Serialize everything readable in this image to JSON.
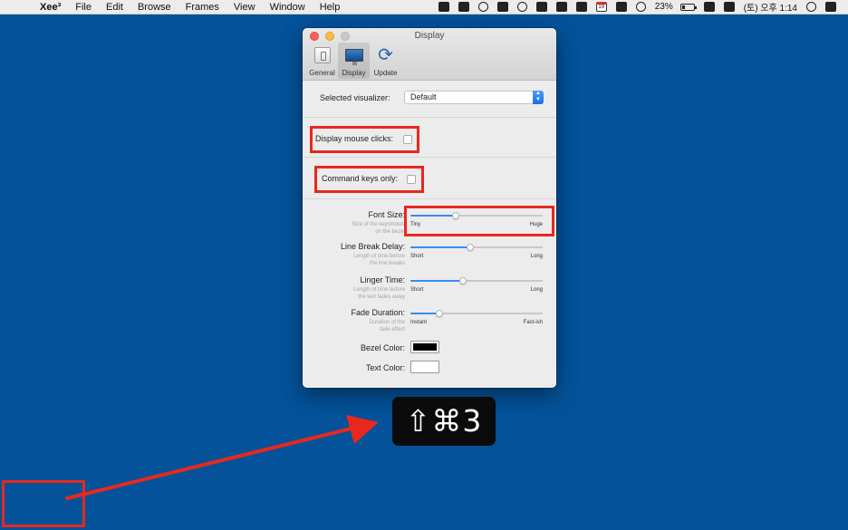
{
  "menubar": {
    "app_name": "Xee³",
    "items": [
      "File",
      "Edit",
      "Browse",
      "Frames",
      "View",
      "Window",
      "Help"
    ],
    "battery_percent": "23%",
    "clock": "(토) 오후 1:14",
    "calendar_day": "19",
    "status_icons": [
      "command-icon",
      "note-icon",
      "moon-icon",
      "a-icon",
      "password-icon",
      "clipboard-icon",
      "dropbox-icon",
      "cloud-icon",
      "calendar-icon",
      "airplay-icon",
      "wifi-icon",
      "bluetooth-icon",
      "volume-icon",
      "search-icon",
      "list-icon"
    ]
  },
  "window": {
    "title": "Display",
    "tabs": [
      {
        "label": "General",
        "icon": "general-icon"
      },
      {
        "label": "Display",
        "icon": "display-icon"
      },
      {
        "label": "Update",
        "icon": "update-icon"
      }
    ],
    "visualizer": {
      "label": "Selected visualizer:",
      "value": "Default"
    },
    "display_mouse_clicks": {
      "label": "Display mouse clicks:",
      "checked": false
    },
    "command_keys_only": {
      "label": "Command keys only:",
      "checked": false
    },
    "sliders": [
      {
        "label": "Font Size:",
        "desc": [
          "Size of the keystrokes",
          "on the bezel"
        ],
        "min": "Tiny",
        "max": "Huge",
        "value": 0.34
      },
      {
        "label": "Line Break Delay:",
        "desc": [
          "Length of time before",
          "the line breaks"
        ],
        "min": "Short",
        "max": "Long",
        "value": 0.45
      },
      {
        "label": "Linger Time:",
        "desc": [
          "Length of time before",
          "the text fades away"
        ],
        "min": "Short",
        "max": "Long",
        "value": 0.4
      },
      {
        "label": "Fade Duration:",
        "desc": [
          "Duration of the",
          "fade effect"
        ],
        "min": "Instant",
        "max": "Fast-ish",
        "value": 0.22
      }
    ],
    "bezel_color": {
      "label": "Bezel Color:",
      "color": "#000000"
    },
    "text_color": {
      "label": "Text Color:",
      "color": "#ffffff"
    }
  },
  "bezel": {
    "keys": "⇧⌘3"
  },
  "colors": {
    "desktop": "#03529a",
    "annotation": "#e8281d",
    "accent": "#3b8af2"
  }
}
